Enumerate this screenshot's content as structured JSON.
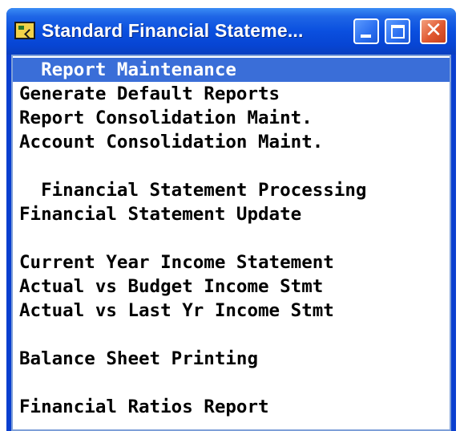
{
  "window": {
    "title": "Standard Financial Stateme...",
    "icon": "app-icon",
    "buttons": [
      "minimize",
      "maximize",
      "close"
    ]
  },
  "menu": {
    "items": [
      {
        "label": "  Report Maintenance",
        "selected": true
      },
      {
        "label": "Generate Default Reports"
      },
      {
        "label": "Report Consolidation Maint."
      },
      {
        "label": "Account Consolidation Maint."
      },
      {
        "label": "  Financial Statement Processing"
      },
      {
        "label": "Financial Statement Update"
      },
      {
        "label": "Current Year Income Statement"
      },
      {
        "label": "Actual vs Budget Income Stmt"
      },
      {
        "label": "Actual vs Last Yr Income Stmt"
      },
      {
        "label": "Balance Sheet Printing"
      },
      {
        "label": "Financial Ratios Report"
      }
    ]
  },
  "colors": {
    "titlebar": "#0a4fdf",
    "selection": "#3a6ed8",
    "close_button": "#e05830"
  }
}
